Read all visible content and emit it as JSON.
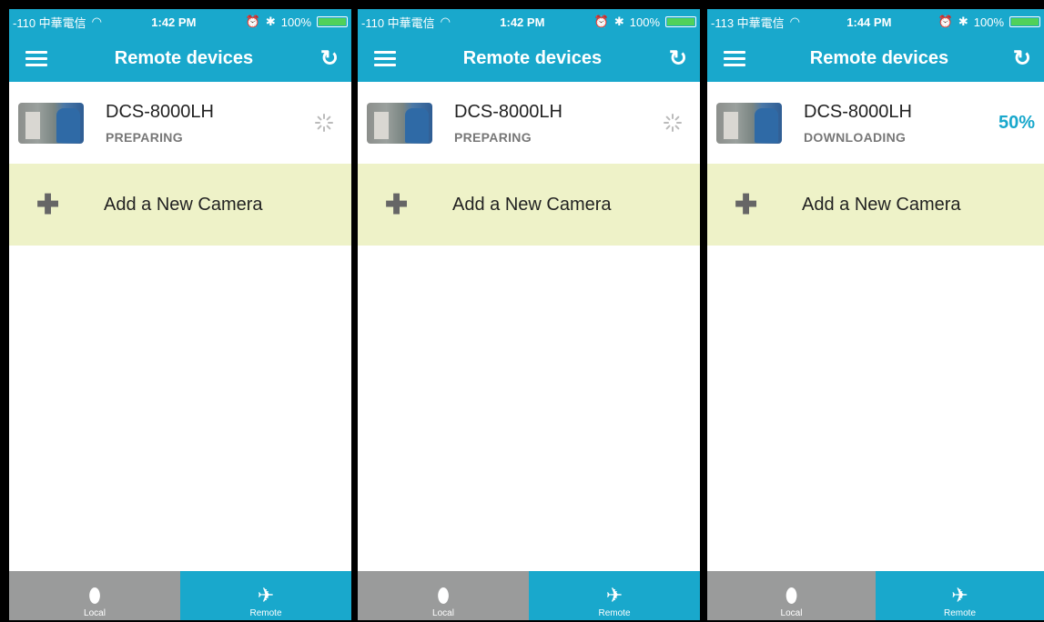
{
  "screens": [
    {
      "status": {
        "carrier": "-110 中華電信",
        "time": "1:42 PM",
        "battery": "100%"
      },
      "nav": {
        "title": "Remote devices"
      },
      "device": {
        "name": "DCS-8000LH",
        "status": "PREPARING",
        "progress": ""
      },
      "add": {
        "label": "Add a New Camera"
      },
      "tabs": {
        "local": "Local",
        "remote": "Remote"
      }
    },
    {
      "status": {
        "carrier": "-110 中華電信",
        "time": "1:42 PM",
        "battery": "100%"
      },
      "nav": {
        "title": "Remote devices"
      },
      "device": {
        "name": "DCS-8000LH",
        "status": "PREPARING",
        "progress": ""
      },
      "add": {
        "label": "Add a New Camera"
      },
      "tabs": {
        "local": "Local",
        "remote": "Remote"
      }
    },
    {
      "status": {
        "carrier": "-113 中華電信",
        "time": "1:44 PM",
        "battery": "100%"
      },
      "nav": {
        "title": "Remote devices"
      },
      "device": {
        "name": "DCS-8000LH",
        "status": "DOWNLOADING",
        "progress": "50%"
      },
      "add": {
        "label": "Add a New Camera"
      },
      "tabs": {
        "local": "Local",
        "remote": "Remote"
      }
    }
  ],
  "icons": {
    "menu": "hamburger-icon",
    "refresh": "refresh-icon",
    "spinner": "loading-spinner-icon",
    "add": "plus-icon",
    "local": "camera-icon",
    "remote": "satellite-dish-icon"
  },
  "colors": {
    "accent": "#19a8cc",
    "add_row_bg": "#eef2c8",
    "tab_inactive": "#9a9b9b"
  }
}
